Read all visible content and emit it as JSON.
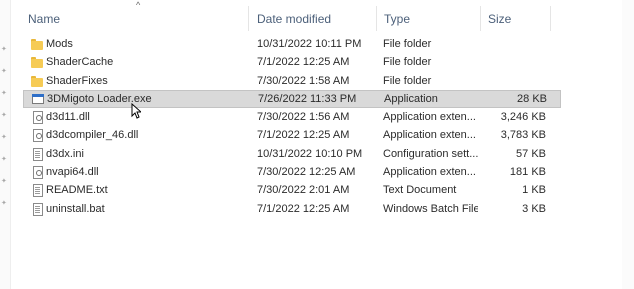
{
  "columns": {
    "name": "Name",
    "date": "Date modified",
    "type": "Type",
    "size": "Size"
  },
  "sort": {
    "column": "name",
    "indicator": "^"
  },
  "files": [
    {
      "name": "Mods",
      "date": "10/31/2022 10:11 PM",
      "type": "File folder",
      "size": "",
      "icon": "folder-icon"
    },
    {
      "name": "ShaderCache",
      "date": "7/1/2022 12:25 AM",
      "type": "File folder",
      "size": "",
      "icon": "folder-icon"
    },
    {
      "name": "ShaderFixes",
      "date": "7/30/2022 1:58 AM",
      "type": "File folder",
      "size": "",
      "icon": "folder-icon"
    },
    {
      "name": "3DMigoto Loader.exe",
      "date": "7/26/2022 11:33 PM",
      "type": "Application",
      "size": "28 KB",
      "icon": "application-icon",
      "selected": true
    },
    {
      "name": "d3d11.dll",
      "date": "7/30/2022 1:56 AM",
      "type": "Application exten...",
      "size": "3,246 KB",
      "icon": "dll-file-icon"
    },
    {
      "name": "d3dcompiler_46.dll",
      "date": "7/1/2022 12:25 AM",
      "type": "Application exten...",
      "size": "3,783 KB",
      "icon": "dll-file-icon"
    },
    {
      "name": "d3dx.ini",
      "date": "10/31/2022 10:10 PM",
      "type": "Configuration sett...",
      "size": "57 KB",
      "icon": "config-file-icon"
    },
    {
      "name": "nvapi64.dll",
      "date": "7/30/2022 12:25 AM",
      "type": "Application exten...",
      "size": "181 KB",
      "icon": "dll-file-icon"
    },
    {
      "name": "README.txt",
      "date": "7/30/2022 2:01 AM",
      "type": "Text Document",
      "size": "1 KB",
      "icon": "text-file-icon"
    },
    {
      "name": "uninstall.bat",
      "date": "7/1/2022 12:25 AM",
      "type": "Windows Batch File",
      "size": "3 KB",
      "icon": "batch-file-icon"
    }
  ],
  "colors": {
    "header_text": "#4c607a",
    "selection": "#d9d9d9",
    "folder": "#f6cb55"
  }
}
